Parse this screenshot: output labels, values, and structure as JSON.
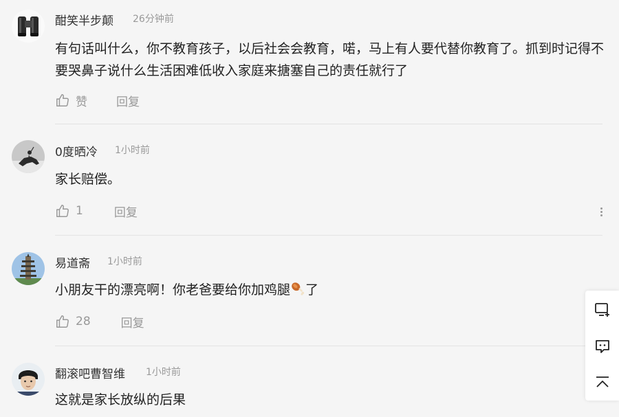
{
  "comments": [
    {
      "username": "酣笑半步颠",
      "time": "26分钟前",
      "text": "有句话叫什么，你不教育孩子，以后社会会教育，喏，马上有人要代替你教育了。抓到时记得不要哭鼻子说什么生活困难低收入家庭来搪塞自己的责任就行了",
      "like_label": "赞",
      "reply_label": "回复"
    },
    {
      "username": "0度晒冷",
      "time": "1小时前",
      "text": "家长赔偿。",
      "like_label": "1",
      "reply_label": "回复"
    },
    {
      "username": "易道斋",
      "time": "1小时前",
      "text_before_emoji": "小朋友干的漂亮啊！你老爸要给你加鸡腿",
      "emoji": "drumstick-icon",
      "text_after_emoji": "了",
      "like_label": "28",
      "reply_label": "回复"
    },
    {
      "username": "翻滚吧曹智维",
      "time": "1小时前",
      "text": "这就是家长放纵的后果"
    }
  ],
  "sidebar": {
    "icons": [
      "screen-add-icon",
      "comment-icon",
      "back-to-top-icon"
    ]
  },
  "colors": {
    "background": "#f5f5f5",
    "text": "#222222",
    "muted": "#999999",
    "divider": "#e3e3e3"
  }
}
